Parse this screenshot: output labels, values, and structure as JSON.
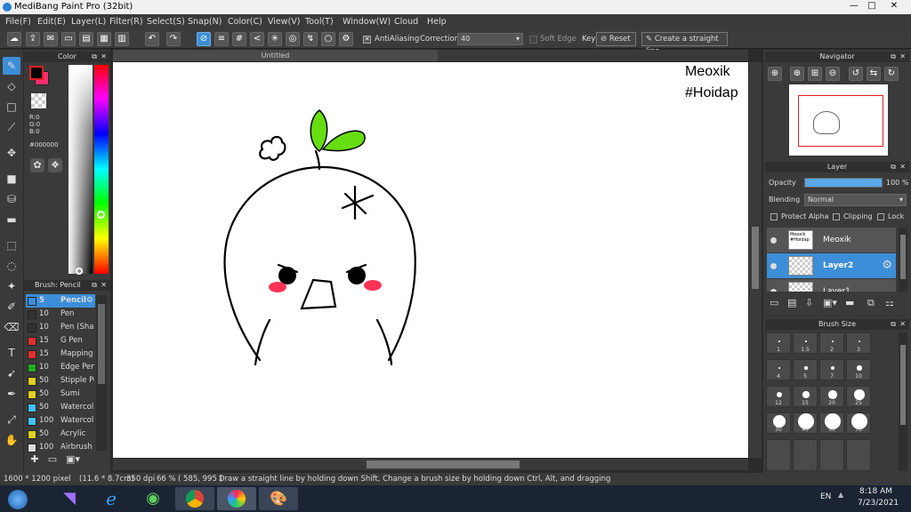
{
  "window": {
    "title": "MediBang Paint Pro (32bit)",
    "minimize": "—",
    "maximize": "□",
    "close": "✕"
  },
  "menu": [
    "File(F)",
    "Edit(E)",
    "Layer(L)",
    "Filter(R)",
    "Select(S)",
    "Snap(N)",
    "Color(C)",
    "View(V)",
    "Tool(T)",
    "Window(W)",
    "Cloud",
    "Help"
  ],
  "toolbar": {
    "antialiasing": "AntiAliasing",
    "correction_label": "Correction",
    "correction_value": "40",
    "soft_edge": "Soft Edge",
    "key": "Key",
    "reset": "Reset",
    "straight_line": "Create a straight line"
  },
  "document": {
    "tab": "Untitled"
  },
  "color_panel": {
    "title": "Color",
    "r": "R:0",
    "g": "G:0",
    "b": "B:0",
    "hex": "#000000",
    "primary": "#000000",
    "secondary": "#ff2d6f"
  },
  "brush_panel": {
    "title": "Brush: Pencil",
    "items": [
      {
        "size": "5",
        "name": "Pencil",
        "color": "#3d8ed8"
      },
      {
        "size": "10",
        "name": "Pen",
        "color": "#333333"
      },
      {
        "size": "10",
        "name": "Pen (Sha",
        "color": "#333333"
      },
      {
        "size": "15",
        "name": "G Pen",
        "color": "#e03030"
      },
      {
        "size": "15",
        "name": "Mapping P",
        "color": "#e03030"
      },
      {
        "size": "10",
        "name": "Edge Pen",
        "color": "#20b020"
      },
      {
        "size": "50",
        "name": "Stipple Pe",
        "color": "#e0d020"
      },
      {
        "size": "50",
        "name": "Sumi",
        "color": "#e0d020"
      },
      {
        "size": "50",
        "name": "Watercol",
        "color": "#40c0f0"
      },
      {
        "size": "100",
        "name": "Watercol",
        "color": "#40c0f0"
      },
      {
        "size": "50",
        "name": "Acrylic",
        "color": "#e0d020"
      },
      {
        "size": "100",
        "name": "Airbrush",
        "color": "#dddddd"
      }
    ]
  },
  "canvas_text": {
    "line1": "Meoxik",
    "line2": "#Hoidap"
  },
  "navigator": {
    "title": "Navigator"
  },
  "layer_panel": {
    "title": "Layer",
    "opacity_label": "Opacity",
    "opacity_value": "100 %",
    "opacity_fraction": 1.0,
    "blending_label": "Blending",
    "blending_value": "Normal",
    "protect_alpha": "Protect Alpha",
    "clipping": "Clipping",
    "lock": "Lock",
    "layers": [
      {
        "name": "Meoxik",
        "thumb": "Meoxik #Hoidap"
      },
      {
        "name": "Layer2",
        "thumb": ""
      },
      {
        "name": "Layer1",
        "thumb": ""
      }
    ]
  },
  "brush_size_panel": {
    "title": "Brush Size",
    "sizes": [
      "1",
      "1.5",
      "2",
      "3",
      "4",
      "5",
      "7",
      "10",
      "12",
      "15",
      "20",
      "25",
      "30",
      "40",
      "50",
      "70"
    ]
  },
  "status": {
    "size": "1600 * 1200 pixel",
    "physical": "(11.6 * 8.7cm)",
    "dpi": "350 dpi",
    "zoom": "66 %",
    "coords": "( 585, 995 )",
    "hint": "Draw a straight line by holding down Shift, Change a brush size by holding down Ctrl, Alt, and dragging"
  },
  "taskbar": {
    "lang": "EN",
    "time": "8:18 AM",
    "date": "7/23/2021"
  }
}
